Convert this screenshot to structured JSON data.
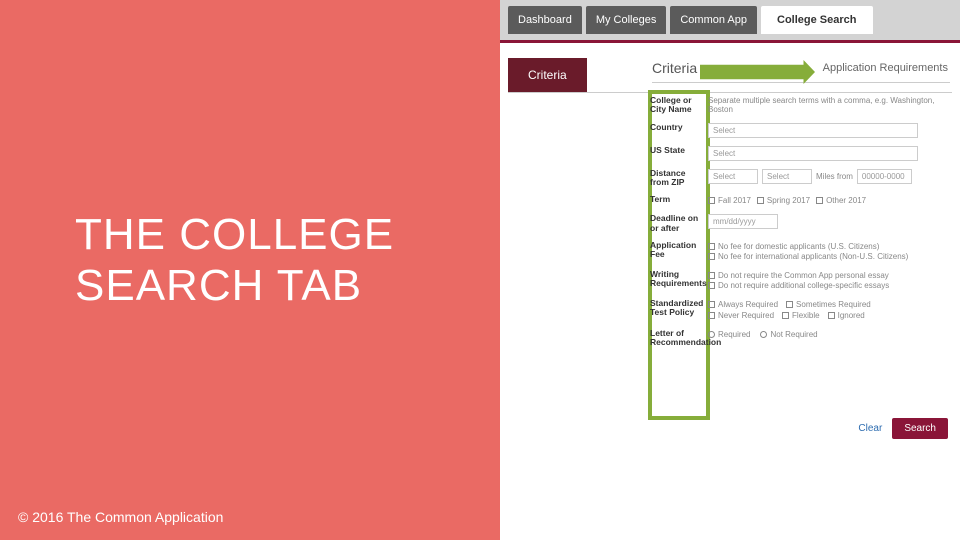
{
  "slide": {
    "title": "THE COLLEGE SEARCH TAB",
    "copyright": "© 2016 The Common Application"
  },
  "nav": {
    "tabs": [
      "Dashboard",
      "My Colleges",
      "Common App",
      "College Search"
    ],
    "active_index": 3
  },
  "subtabs": {
    "active": "Criteria",
    "other": "Application Requirements"
  },
  "panel_header": "Criteria",
  "form": {
    "college_name": {
      "label": "College or City Name",
      "hint": "Separate multiple search terms with a comma, e.g. Washington, Boston"
    },
    "country": {
      "label": "Country",
      "placeholder": "Select"
    },
    "us_state": {
      "label": "US State",
      "placeholder": "Select"
    },
    "distance": {
      "label": "Distance from ZIP",
      "sel1": "Select",
      "sel2": "Select",
      "miles_label": "Miles from",
      "zip_placeholder": "00000-0000"
    },
    "term": {
      "label": "Term",
      "opts": [
        "Fall 2017",
        "Spring 2017",
        "Other 2017"
      ]
    },
    "deadline": {
      "label": "Deadline on or after",
      "placeholder": "mm/dd/yyyy"
    },
    "app_fee": {
      "label": "Application Fee",
      "opts": [
        "No fee for domestic applicants (U.S. Citizens)",
        "No fee for international applicants (Non-U.S. Citizens)"
      ]
    },
    "writing": {
      "label": "Writing Requirements",
      "opts": [
        "Do not require the Common App personal essay",
        "Do not require additional college-specific essays"
      ]
    },
    "test_policy": {
      "label": "Standardized Test Policy",
      "opts": [
        "Always Required",
        "Sometimes Required",
        "Never Required",
        "Flexible",
        "Ignored"
      ]
    },
    "letter": {
      "label": "Letter of Recommendation",
      "opts": [
        "Required",
        "Not Required"
      ]
    }
  },
  "buttons": {
    "clear": "Clear",
    "search": "Search"
  }
}
